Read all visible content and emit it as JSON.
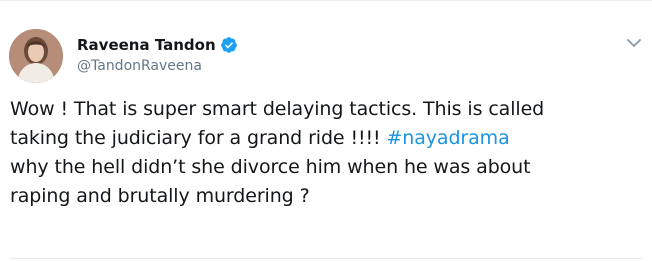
{
  "tweet": {
    "author": {
      "display_name": "Raveena Tandon",
      "handle": "@TandonRaveena",
      "verified": true,
      "avatar_icon": "avatar-photo"
    },
    "text_lines": [
      "Wow ! That is super smart delaying tactics. This is called",
      "taking the judiciary for a grand ride !!!! ",
      " why the hell didn’t she divorce him when he was about",
      "raping and brutally murdering ?"
    ],
    "hashtag": "#nayadrama",
    "menu_icon": "chevron-down-icon"
  },
  "colors": {
    "text": "#14171a",
    "secondary": "#657786",
    "link": "#1b95e0",
    "verified": "#1da1f2",
    "divider": "#e6ecf0"
  }
}
